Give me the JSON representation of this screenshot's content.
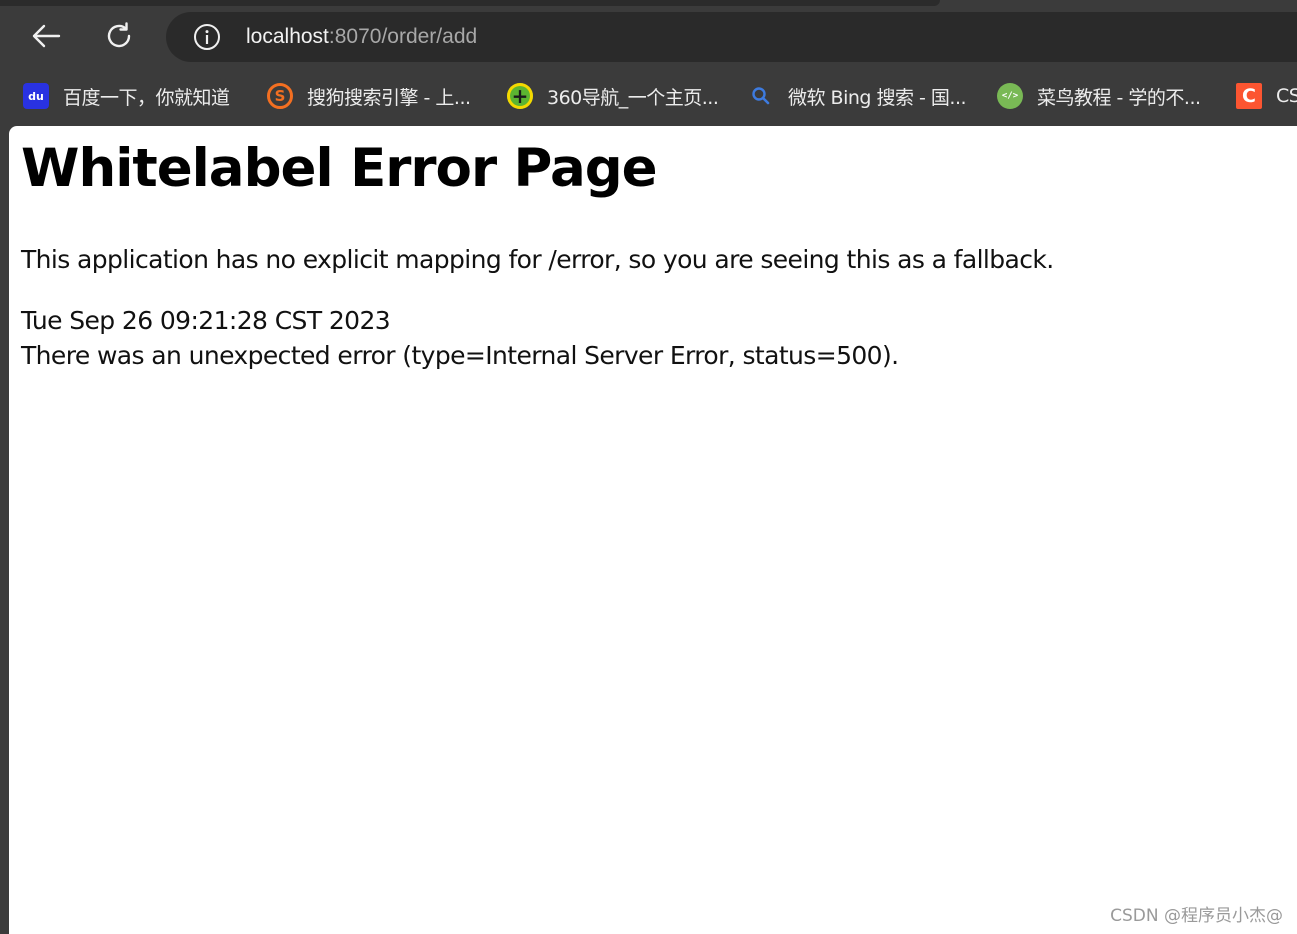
{
  "browser": {
    "url_host": "localhost",
    "url_path": ":8070/order/add",
    "back_icon": "back-arrow-icon",
    "reload_icon": "reload-icon",
    "site_info_icon": "info-icon"
  },
  "bookmarks": [
    {
      "label": "百度一下，你就知道",
      "icon": "baidu-icon",
      "icon_text": "du",
      "color": "#2932e1"
    },
    {
      "label": "搜狗搜索引擎 - 上...",
      "icon": "sogou-icon",
      "icon_text": "S",
      "color": "#f36f21"
    },
    {
      "label": "360导航_一个主页...",
      "icon": "360-icon",
      "icon_text": "+",
      "color": "#5cb531"
    },
    {
      "label": "微软 Bing 搜索 - 国...",
      "icon": "bing-search-icon",
      "icon_text": "",
      "color": "#1a6fd6"
    },
    {
      "label": "菜鸟教程 - 学的不...",
      "icon": "runoob-icon",
      "icon_text": "</>",
      "color": "#79b955"
    },
    {
      "label": "CS",
      "icon": "csdn-icon",
      "icon_text": "C",
      "color": "#fc5531"
    }
  ],
  "page": {
    "title": "Whitelabel Error Page",
    "message": "This application has no explicit mapping for /error, so you are seeing this as a fallback.",
    "timestamp": "Tue Sep 26 09:21:28 CST 2023",
    "error": "There was an unexpected error (type=Internal Server Error, status=500)."
  },
  "watermark": "CSDN @程序员小杰@"
}
